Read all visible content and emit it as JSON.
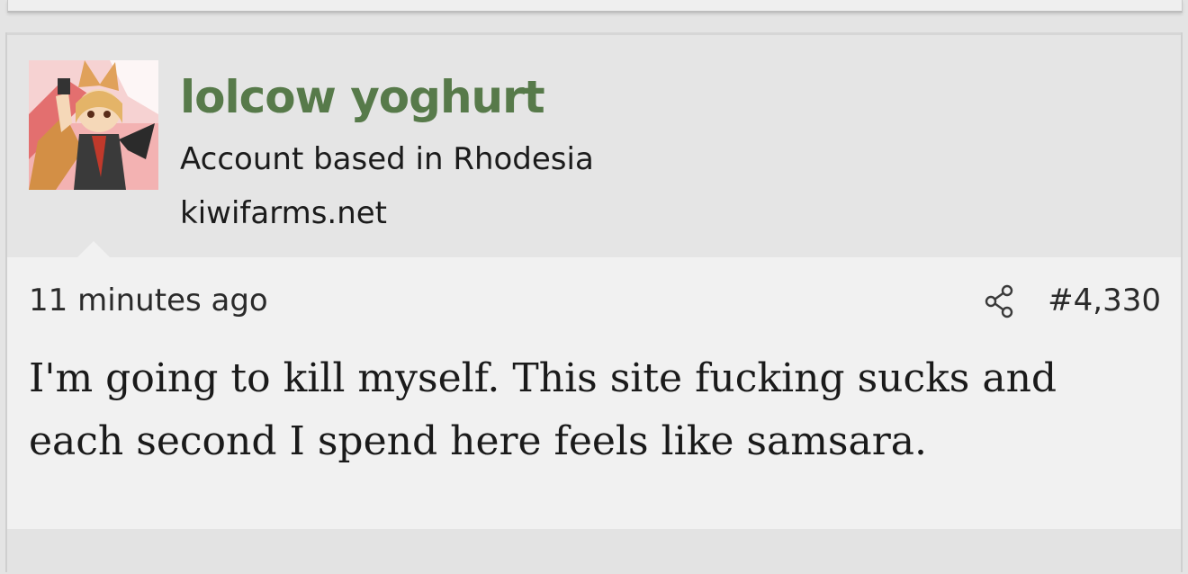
{
  "post": {
    "author": {
      "username": "lolcow yoghurt",
      "user_title": "Account based in Rhodesia",
      "site": "kiwifarms.net",
      "avatar": "anime-fox-girl-avatar"
    },
    "timestamp": "11 minutes ago",
    "share_icon": "share-icon",
    "post_number": "#4,330",
    "body": "I'm going to kill myself. This site fucking sucks and each second I spend here feels like samsara."
  },
  "colors": {
    "username": "#577a4a",
    "user_block_bg": "#e5e5e5",
    "post_bg": "#f1f1f1",
    "text": "#1a1a1a"
  }
}
